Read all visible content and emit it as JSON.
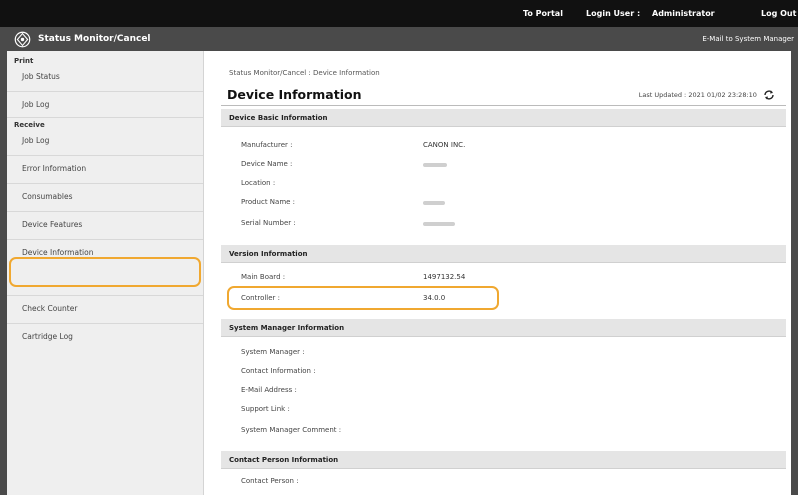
{
  "topbar": {
    "portal": "To Portal",
    "login_user": "Login User :",
    "user_name": "Administrator",
    "logout": "Log Out"
  },
  "header": {
    "app_title": "Status Monitor/Cancel",
    "mail_link": "E-Mail to System Manager"
  },
  "sidebar": {
    "print_heading": "Print",
    "print_items": [
      "Job Status",
      "Job Log"
    ],
    "receive_heading": "Receive",
    "receive_items": [
      "Job Log"
    ],
    "other_items": [
      "Error Information",
      "Consumables",
      "Device Features",
      "Device Information",
      "Check Counter",
      "Cartridge Log"
    ],
    "selected": "Device Information"
  },
  "main": {
    "breadcrumb": "Status Monitor/Cancel : Device Information",
    "title": "Device Information",
    "last_updated": "Last Updated : 2021 01/02 23:28:10",
    "sections": {
      "basic": {
        "title": "Device Basic Information",
        "manufacturer_label": "Manufacturer :",
        "manufacturer_value": "CANON INC.",
        "device_name_label": "Device Name :",
        "location_label": "Location :",
        "product_name_label": "Product Name :",
        "serial_label": "Serial Number :"
      },
      "version": {
        "title": "Version Information",
        "main_board_label": "Main Board :",
        "main_board_value": "1497132.54",
        "controller_label": "Controller :",
        "controller_value": "34.0.0"
      },
      "sysmgr": {
        "title": "System Manager Information",
        "manager_label": "System Manager :",
        "contact_label": "Contact Information :",
        "email_label": "E-Mail Address :",
        "support_label": "Support Link :",
        "comment_label": "System Manager Comment :"
      },
      "contact": {
        "title": "Contact Person Information",
        "person_label": "Contact Person :"
      }
    }
  },
  "colors": {
    "highlight": "#f0a830",
    "topbar": "#111111",
    "titlebar": "#4a4a4a",
    "section_header": "#e5e5e5"
  }
}
